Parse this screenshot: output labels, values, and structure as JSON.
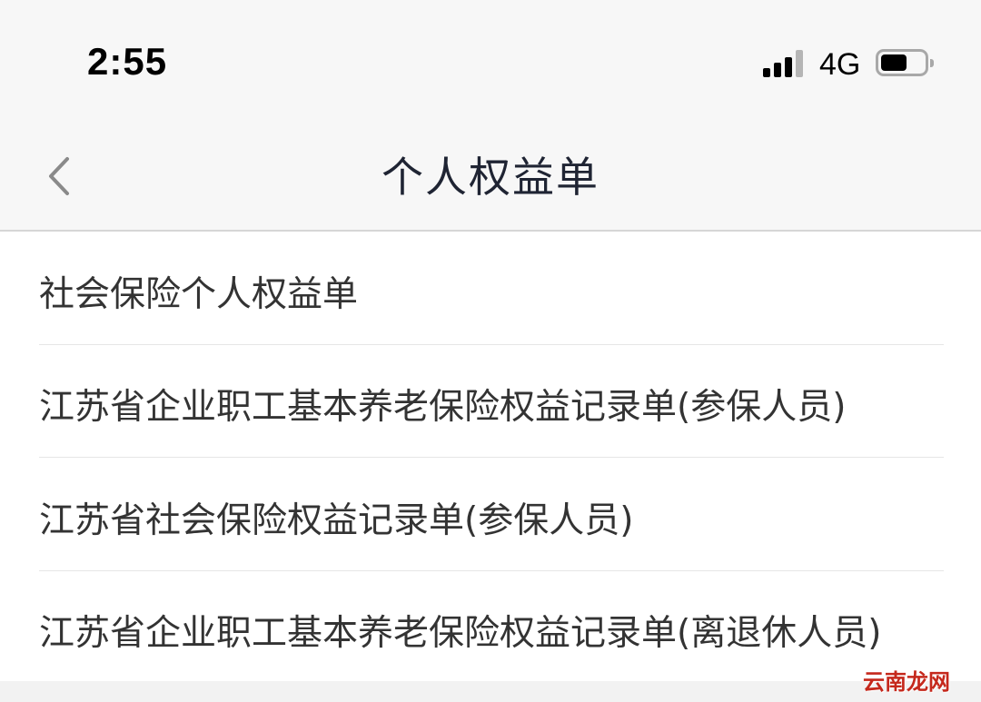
{
  "status_bar": {
    "time": "2:55",
    "network": "4G",
    "signal_icon": "cellular-signal-icon",
    "battery_icon": "battery-icon"
  },
  "nav": {
    "title": "个人权益单",
    "back_icon": "chevron-left-icon"
  },
  "items": [
    {
      "label": "社会保险个人权益单"
    },
    {
      "label": "江苏省企业职工基本养老保险权益记录单(参保人员)"
    },
    {
      "label": "江苏省社会保险权益记录单(参保人员)"
    },
    {
      "label": "江苏省企业职工基本养老保险权益记录单(离退休人员)"
    }
  ],
  "watermark": "云南龙网",
  "colors": {
    "nav_background": "#f7f7f7",
    "title": "#1f2433",
    "item_text": "#333333",
    "divider": "#e6e6e6",
    "watermark": "#c5281c"
  }
}
